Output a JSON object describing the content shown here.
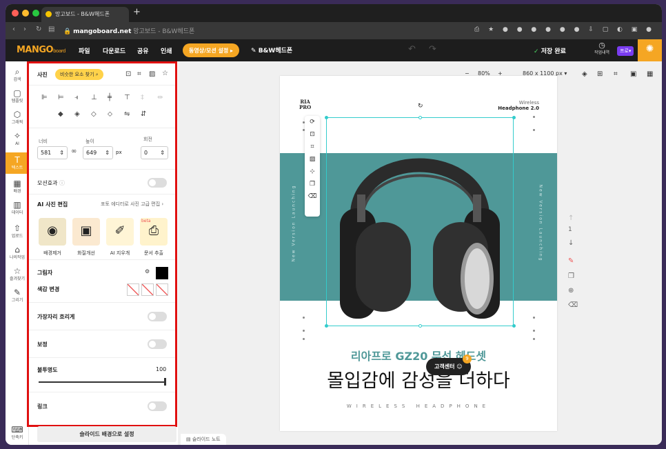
{
  "browser": {
    "tab_title": "망고보드 - B&W헤드폰",
    "url_host": "mangoboard.net",
    "url_title": "망고보드 - B&W헤드폰"
  },
  "app": {
    "logo": "MANGO",
    "logo_sub": "board",
    "menu": [
      "파일",
      "다운로드",
      "공유",
      "인쇄"
    ],
    "promo": "동영상/모션 설정",
    "doc_name": "B&W헤드폰",
    "saved": "저장 완료",
    "history_label": "작업내역",
    "pro_label": "프로"
  },
  "sidebar": [
    {
      "icon": "search-icon",
      "glyph": "⌕",
      "label": "검색"
    },
    {
      "icon": "template-icon",
      "glyph": "▢",
      "label": "템플릿"
    },
    {
      "icon": "graphic-icon",
      "glyph": "⬡",
      "label": "그래픽"
    },
    {
      "icon": "ai-icon",
      "glyph": "✧",
      "label": "AI"
    },
    {
      "icon": "text-icon",
      "glyph": "T",
      "label": "텍스트"
    },
    {
      "icon": "background-icon",
      "glyph": "▦",
      "label": "배경"
    },
    {
      "icon": "data-icon",
      "glyph": "▥",
      "label": "데이터"
    },
    {
      "icon": "upload-icon",
      "glyph": "⇧",
      "label": "업로드"
    },
    {
      "icon": "my-work-icon",
      "glyph": "⌂",
      "label": "나의작업"
    },
    {
      "icon": "favorite-icon",
      "glyph": "☆",
      "label": "즐겨찾기"
    },
    {
      "icon": "draw-icon",
      "glyph": "✎",
      "label": "그리기"
    }
  ],
  "shortcut_label": "단축키",
  "panel": {
    "title": "사진",
    "similar_btn": "비슷한 요소 찾기",
    "width_label": "너비",
    "width": "581",
    "height_label": "높이",
    "height": "649",
    "unit": "px",
    "rotate_label": "회전",
    "rotate": "0",
    "motion": "모션효과",
    "ai_edit": "AI 사진 편집",
    "ai_link": "포토 에디터로 사진 고급 편집",
    "ai_tools": [
      {
        "label": "배경제거",
        "glyph": "◉"
      },
      {
        "label": "화질개선",
        "glyph": "▣"
      },
      {
        "label": "AI 지우개",
        "glyph": "✐"
      },
      {
        "label": "문서 추출",
        "glyph": "⎙",
        "badge": "beta"
      }
    ],
    "shadow": "그림자",
    "color_change": "색감 변경",
    "blur_edge": "가장자리 흐리게",
    "correction": "보정",
    "opacity": "불투명도",
    "opacity_value": "100",
    "link": "링크"
  },
  "bg_button": "슬라이드 배경으로 설정",
  "slide_note": "슬라이드 노트",
  "toolbar": {
    "zoom": "80%",
    "size": "860 x 1100 px"
  },
  "design": {
    "brand_top": "RIA",
    "brand_bottom": "PRO",
    "wireless": "Wireless",
    "headphone": "Headphone 2.0",
    "side_text": "New Version Launching",
    "subtitle": "리아프로 GZ20 무선 헤드셋",
    "headline": "몰입감에 감성을 더하다",
    "footer": "WIRELESS HEADPHONE",
    "accent": "#4f9898"
  },
  "page_number": "1",
  "help": "고객센터",
  "help_badge": "9"
}
